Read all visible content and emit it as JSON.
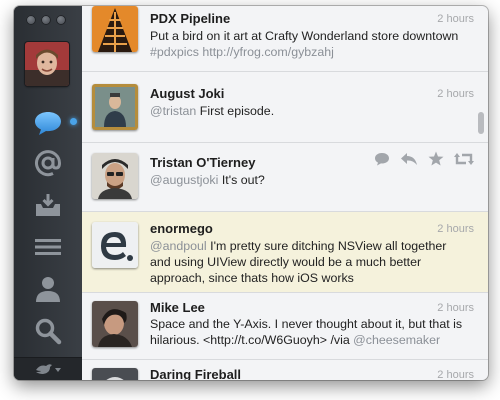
{
  "sidebar": {
    "items": [
      {
        "name": "timeline",
        "icon": "speech-bubble-icon"
      },
      {
        "name": "mentions",
        "icon": "at-sign-icon"
      },
      {
        "name": "messages",
        "icon": "inbox-icon"
      },
      {
        "name": "lists",
        "icon": "list-lines-icon"
      },
      {
        "name": "profile",
        "icon": "person-icon"
      },
      {
        "name": "search",
        "icon": "magnifier-icon"
      }
    ],
    "bottom_icon": "bird-dropdown-icon"
  },
  "tweets": [
    {
      "name": "PDX Pipeline",
      "time": "2 hours",
      "text_plain": "Put a bird on it art at Crafty Wonderland store downtown ",
      "hashtag": "#pdxpics",
      "link": "http://yfrog.com/gybzahj"
    },
    {
      "name": "August Joki",
      "time": "2 hours",
      "mention": "@tristan",
      "text_plain": " First episode."
    },
    {
      "name": "Tristan O'Tierney",
      "mention": "@augustjoki",
      "text_plain": " It's out?",
      "actions": [
        "reply-bubble-icon",
        "reply-arrow-icon",
        "star-icon",
        "retweet-icon"
      ]
    },
    {
      "name": "enormego",
      "time": "2 hours",
      "mention": "@andpoul",
      "text_plain": " I'm pretty sure ditching NSView all together and using UIView directly would be a much better approach, since thats how iOS works"
    },
    {
      "name": "Mike Lee",
      "time": "2 hours",
      "text_plain": "Space and the Y-Axis. I never thought about it, but that is hilarious. <http://t.co/W6Guoyh> /via ",
      "mention": "@cheesemaker"
    },
    {
      "name": "Daring Fireball",
      "time": "2 hours"
    }
  ],
  "colors": {
    "sidebar": "#33373c",
    "timeline": "#f3f4f6",
    "highlight": "#f5f2dc",
    "accent": "#4aa3e8",
    "muted_link": "#8b9097"
  }
}
